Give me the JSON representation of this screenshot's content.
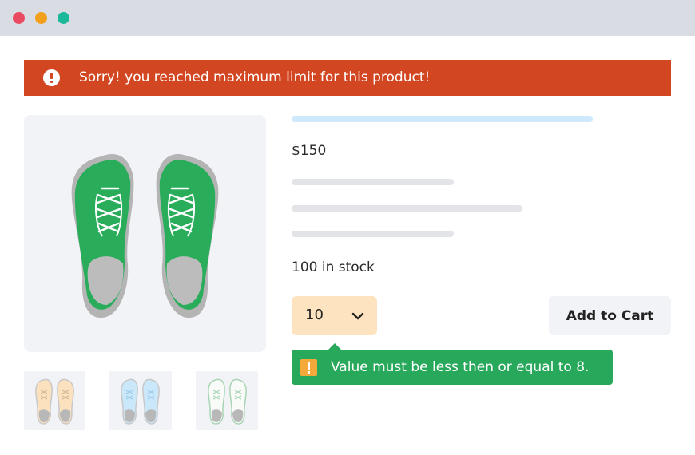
{
  "window": {
    "controls": [
      "close",
      "minimize",
      "maximize"
    ]
  },
  "alert": {
    "message": "Sorry! you reached maximum limit for this product!",
    "icon": "exclamation-circle-icon",
    "color": "#d34622"
  },
  "product": {
    "price": "$150",
    "stock": "100 in stock",
    "main_image_icon": "green-sneakers",
    "thumbnails": [
      "orange-sneakers",
      "blue-sneakers",
      "white-sneakers"
    ]
  },
  "quantity": {
    "value": "10",
    "icon": "chevron-down-icon"
  },
  "actions": {
    "add_to_cart": "Add to Cart"
  },
  "validation": {
    "message": "Value must be less then or equal to 8.",
    "icon": "warning-icon",
    "color": "#28a85b"
  }
}
